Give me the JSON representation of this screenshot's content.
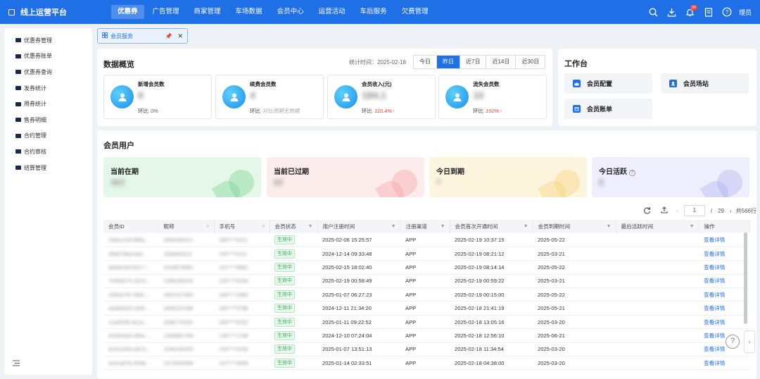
{
  "app": {
    "title": "线上运营平台",
    "user": "理员",
    "notification_count": "99"
  },
  "nav": [
    {
      "label": "优惠券",
      "active": true
    },
    {
      "label": "广告管理"
    },
    {
      "label": "商家管理"
    },
    {
      "label": "车场数据"
    },
    {
      "label": "会员中心"
    },
    {
      "label": "运营活动"
    },
    {
      "label": "车后服务"
    },
    {
      "label": "欠费管理"
    }
  ],
  "sidebar": {
    "items": [
      "优惠券管理",
      "优惠券账单",
      "优惠券查询",
      "发券统计",
      "用券统计",
      "售券明细",
      "合约管理",
      "合约审核",
      "结算管理"
    ]
  },
  "tab": {
    "label": "会员服务"
  },
  "overview": {
    "title": "数据概览",
    "stat_time": "统计时间：2025-02-18",
    "ranges": [
      "今日",
      "昨日",
      "近7日",
      "近14日",
      "近30日"
    ],
    "active_range": "昨日",
    "cards": [
      {
        "label": "新增会员数",
        "value": "6",
        "trend_label": "环比",
        "trend_value": "0%",
        "trend": "none"
      },
      {
        "label": "续费会员数",
        "value": "4",
        "trend_label": "环比",
        "trend_value": "对比周期无数据",
        "trend": "empty"
      },
      {
        "label": "会员收入(元)",
        "value": "184.1",
        "trend_label": "环比",
        "trend_value": "110.4%",
        "trend": "up"
      },
      {
        "label": "流失会员数",
        "value": "10",
        "trend_label": "环比",
        "trend_value": "150%",
        "trend": "up"
      }
    ]
  },
  "workbench": {
    "title": "工作台",
    "buttons": [
      "会员配置",
      "会员场站",
      "会员账单"
    ]
  },
  "members": {
    "title": "会员用户",
    "summary": [
      {
        "label": "当前在期",
        "value": "483",
        "color": "#e4f7e8",
        "accent": "#6ccf86"
      },
      {
        "label": "当前已过期",
        "value": "83",
        "color": "#fdecec",
        "accent": "#f49a9a"
      },
      {
        "label": "今日到期",
        "value": "7",
        "color": "#fdf5de",
        "accent": "#f5cf6b"
      },
      {
        "label": "今日活跃",
        "value": "8",
        "color": "#eeeefc",
        "accent": "#a9a9ef"
      }
    ],
    "pager": {
      "current": "1",
      "total_pages": "29",
      "total": "共566行"
    },
    "columns": [
      "会员ID",
      "昵称",
      "手机号",
      "会员状态",
      "用户注册时间",
      "注册渠道",
      "会员首次开通时间",
      "会员到期时间",
      "最后活跃时间",
      "操作"
    ],
    "rows": [
      [
        "29d1e126-f68a...",
        "1806285221",
        "180****5221",
        "生效中",
        "2025-02-06 15:25:57",
        "APP",
        "2025-02-19 10:37:15",
        "2025-05-22",
        "",
        "查看详情"
      ],
      [
        "458379ba-ba2...",
        "1550830111",
        "155****0111",
        "生效中",
        "2024-12-14 09:33:48",
        "APP",
        "2025-02-19 08:21:12",
        "2025-03-21",
        "",
        "查看详情"
      ],
      [
        "da69c4af-6317-...",
        "1516874682",
        "151****4682",
        "生效中",
        "2025-02-15 18:02:40",
        "APP",
        "2025-02-19 08:14:14",
        "2025-05-22",
        "",
        "查看详情"
      ],
      [
        "7e05d274-32c0...",
        "1356180244",
        "135****0244",
        "生效中",
        "2025-02-19 00:58:49",
        "APP",
        "2025-02-19 00:59:22",
        "2025-03-21",
        "",
        "查看详情"
      ],
      [
        "23bcfc78-7893-...",
        "1801517580",
        "180****1580",
        "生效中",
        "2025-01-07 06:27:23",
        "APP",
        "2025-02-19 00:15:00",
        "2025-05-22",
        "",
        "查看详情"
      ],
      [
        "a5ab4026-293f...",
        "1804215788",
        "180****5788",
        "生效中",
        "2024-12-11 21:34:20",
        "APP",
        "2025-02-18 21:41:19",
        "2025-05-21",
        "",
        "查看详情"
      ],
      [
        "c1a0f295-dcca...",
        "1836775252",
        "183****5252",
        "生效中",
        "2025-01-11 09:22:52",
        "APP",
        "2025-02-18 13:05:16",
        "2025-03-20",
        "",
        "查看详情"
      ],
      [
        "d1092a94-065c...",
        "1395881758",
        "139****1758",
        "生效中",
        "2024-12-10 07:24:04",
        "APP",
        "2025-02-18 12:56:10",
        "2025-06-21",
        "",
        "查看详情"
      ],
      [
        "81813300-a972...",
        "1535190233",
        "153****0233",
        "生效中",
        "2025-01-07 13:51:13",
        "APP",
        "2025-02-18 11:34:54",
        "2025-03-20",
        "",
        "查看详情"
      ],
      [
        "ac41a07b-453b...",
        "1373542848",
        "137****2848",
        "生效中",
        "2025-01-14 02:33:51",
        "APP",
        "2025-02-18 04:38:00",
        "2025-03-20",
        "",
        "查看详情"
      ]
    ]
  },
  "colors": {
    "primary": "#1f6fe6",
    "success": "#2fb356",
    "danger": "#f5423e"
  }
}
